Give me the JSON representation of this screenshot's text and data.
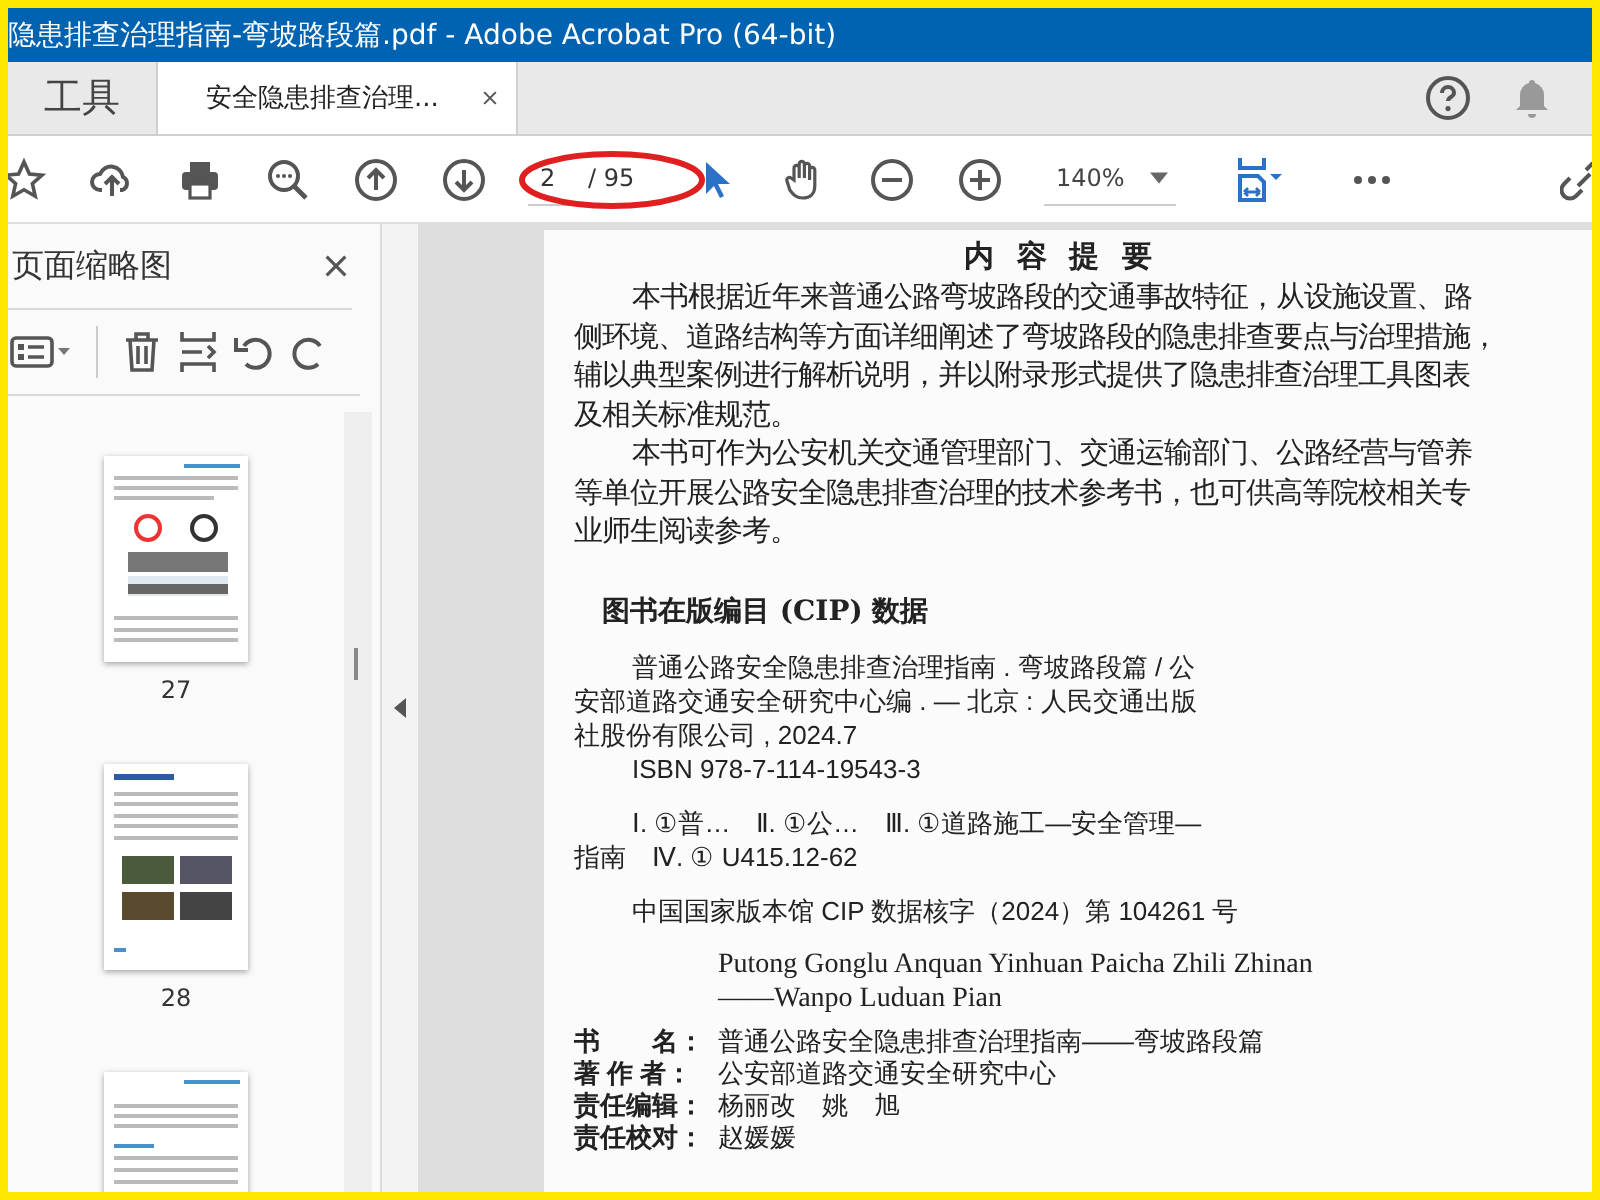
{
  "window": {
    "title": "隐患排查治理指南-弯坡路段篇.pdf - Adobe Acrobat Pro (64-bit)"
  },
  "tabs": [
    {
      "label": "工具",
      "selected": false,
      "closable": false
    },
    {
      "label": "安全隐患排查治理...",
      "selected": true,
      "closable": true
    }
  ],
  "toolbar": {
    "page_field": {
      "value": "2",
      "total": "/ 95"
    },
    "zoom": {
      "value": "140%"
    }
  },
  "sidebar": {
    "title": "页面缩略图",
    "thumbnails": [
      {
        "label": "27",
        "kind": "signs"
      },
      {
        "label": "28",
        "kind": "photos"
      },
      {
        "kind": "text"
      }
    ]
  },
  "document": {
    "abstract": {
      "title": "内 容 提 要",
      "paragraphs": [
        [
          "本书根据近年来普通公路弯坡路段的交通事故特征，从设施设置、路",
          "侧环境、道路结构等方面详细阐述了弯坡路段的隐患排查要点与治理措施，",
          "辅以典型案例进行解析说明，并以附录形式提供了隐患排查治理工具图表",
          "及相关标准规范。"
        ],
        [
          "本书可作为公安机关交通管理部门、交通运输部门、公路经营与管养",
          "等单位开展公路安全隐患排查治理的技术参考书，也可供高等院校相关专",
          "业师生阅读参考。"
        ]
      ]
    },
    "cip": {
      "title": "图书在版编目 (CIP) 数据",
      "entries": [
        [
          "普通公路安全隐患排查治理指南 . 弯坡路段篇 / 公",
          "安部道路交通安全研究中心编 . — 北京 : 人民交通出版",
          "社股份有限公司 , 2024.7",
          "ISBN 978-7-114-19543-3"
        ],
        [
          "Ⅰ. ①普…　Ⅱ. ①公…　Ⅲ. ①道路施工—安全管理—",
          "指南　Ⅳ. ① U415.12-62"
        ],
        [
          "中国国家版本馆 CIP 数据核字（2024）第 104261 号"
        ]
      ]
    },
    "pinyin": [
      "Putong Gonglu Anquan Yinhuan Paicha Zhili Zhinan",
      "——Wanpo Luduan Pian"
    ],
    "credits": [
      {
        "label": "书　　名：",
        "value": "普通公路安全隐患排查治理指南——弯坡路段篇"
      },
      {
        "label": "著 作 者：",
        "value": "公安部道路交通安全研究中心"
      },
      {
        "label": "责任编辑：",
        "value": "杨丽改　姚　旭"
      },
      {
        "label": "责任校对：",
        "value": "赵媛媛"
      }
    ]
  }
}
